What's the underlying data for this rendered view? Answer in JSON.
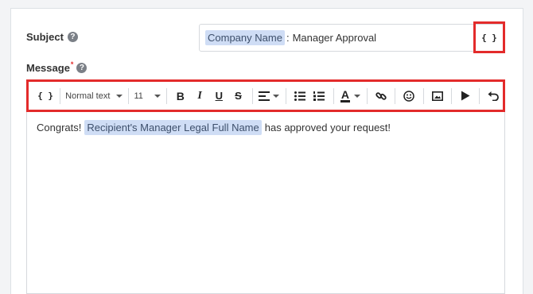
{
  "subject": {
    "label": "Subject",
    "help_icon": "question-circle-icon",
    "token": "Company Name",
    "separator": ":",
    "text": "Manager Approval",
    "insert_variable_label": "{ }"
  },
  "message": {
    "label": "Message",
    "required_mark": "*",
    "help_icon": "question-circle-icon"
  },
  "toolbar": {
    "variable_label": "{ }",
    "style_value": "Normal text",
    "size_value": "11",
    "bold": "B",
    "italic": "I",
    "underline": "U",
    "strike": "S",
    "font_color": "A"
  },
  "body": {
    "prefix": "Congrats!",
    "token": "Recipient's Manager Legal Full Name",
    "suffix": "has approved your request!"
  },
  "colors": {
    "highlight_border": "#e32b2b",
    "token_bg": "#cfddf5"
  }
}
